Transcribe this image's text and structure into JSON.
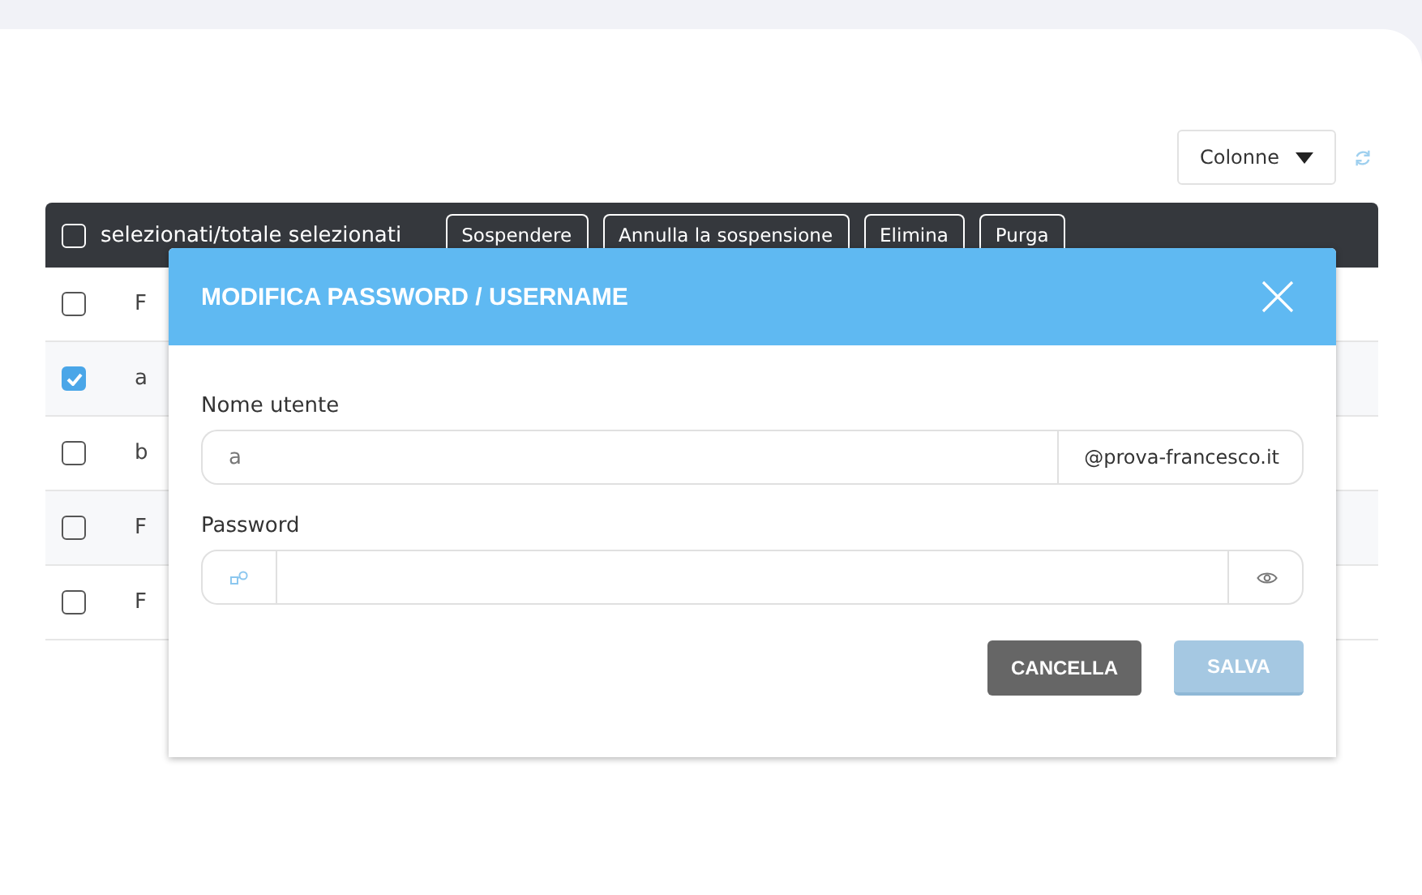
{
  "toolbar": {
    "columns_button": "Colonne"
  },
  "table": {
    "header": {
      "select_all": {
        "checked": false
      },
      "label": "selezionati/totale selezionati",
      "actions": [
        "Sospendere",
        "Annulla la sospensione",
        "Elimina",
        "Purga"
      ]
    },
    "rows": [
      {
        "checked": false,
        "cell": "F"
      },
      {
        "checked": true,
        "cell": "a"
      },
      {
        "checked": false,
        "cell": "b"
      },
      {
        "checked": false,
        "cell": "F"
      },
      {
        "checked": false,
        "cell": "F"
      }
    ]
  },
  "dialog": {
    "title": "MODIFICA PASSWORD / USERNAME",
    "fields": [
      {
        "kind": "text",
        "label": "Nome utente",
        "value": "a",
        "suffix": "@prova-francesco.it"
      },
      {
        "kind": "password",
        "label": "Password"
      }
    ],
    "buttons": [
      {
        "kind": "cancel",
        "label": "CANCELLA",
        "disabled": false
      },
      {
        "kind": "primary",
        "label": "SALVA",
        "disabled": true
      }
    ]
  }
}
